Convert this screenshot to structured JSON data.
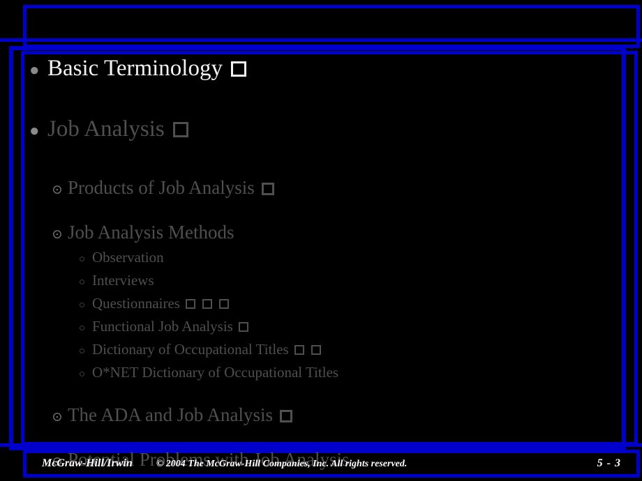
{
  "slide": {
    "background_color": "#000000",
    "frame_color": "#0000CC",
    "bright_text_color": "#F2F2F2",
    "dim_text_color": "#4F4F4F",
    "bullets": [
      {
        "level": 1,
        "bullet_glyph": "●",
        "text": "Basic Terminology",
        "tone": "bright",
        "boxes": 1
      },
      {
        "level": 1,
        "bullet_glyph": "●",
        "text": "Job Analysis",
        "tone": "dim",
        "boxes": 1
      },
      {
        "level": 2,
        "bullet_glyph": "⊙",
        "text": "Products of Job Analysis",
        "tone": "dim",
        "boxes": 1
      },
      {
        "level": 2,
        "bullet_glyph": "⊙",
        "text": "Job Analysis Methods",
        "tone": "dim",
        "boxes": 0
      },
      {
        "level": 3,
        "bullet_glyph": "○",
        "text": "Observation",
        "tone": "dim",
        "boxes": 0
      },
      {
        "level": 3,
        "bullet_glyph": "○",
        "text": "Interviews",
        "tone": "dim",
        "boxes": 0
      },
      {
        "level": 3,
        "bullet_glyph": "○",
        "text": "Questionnaires",
        "tone": "dim",
        "boxes": 3
      },
      {
        "level": 3,
        "bullet_glyph": "○",
        "text": "Functional Job Analysis",
        "tone": "dim",
        "boxes": 1
      },
      {
        "level": 3,
        "bullet_glyph": "○",
        "text": "Dictionary of Occupational Titles",
        "tone": "dim",
        "boxes": 2
      },
      {
        "level": 3,
        "bullet_glyph": "○",
        "text": "O*NET Dictionary of Occupational Titles",
        "tone": "dim",
        "boxes": 0
      },
      {
        "level": 2,
        "bullet_glyph": "⊙",
        "text": "The ADA and Job Analysis",
        "tone": "dim",
        "boxes": 1
      },
      {
        "level": 2,
        "bullet_glyph": "⊙",
        "text": "Potential Problems with Job Analysis",
        "tone": "dim",
        "boxes": 0
      }
    ]
  },
  "footer": {
    "brand": "McGraw-Hill/Irwin",
    "copyright": "© 2004 The McGraw-Hill Companies, Inc. All rights reserved.",
    "page_number": "5 - 3"
  }
}
